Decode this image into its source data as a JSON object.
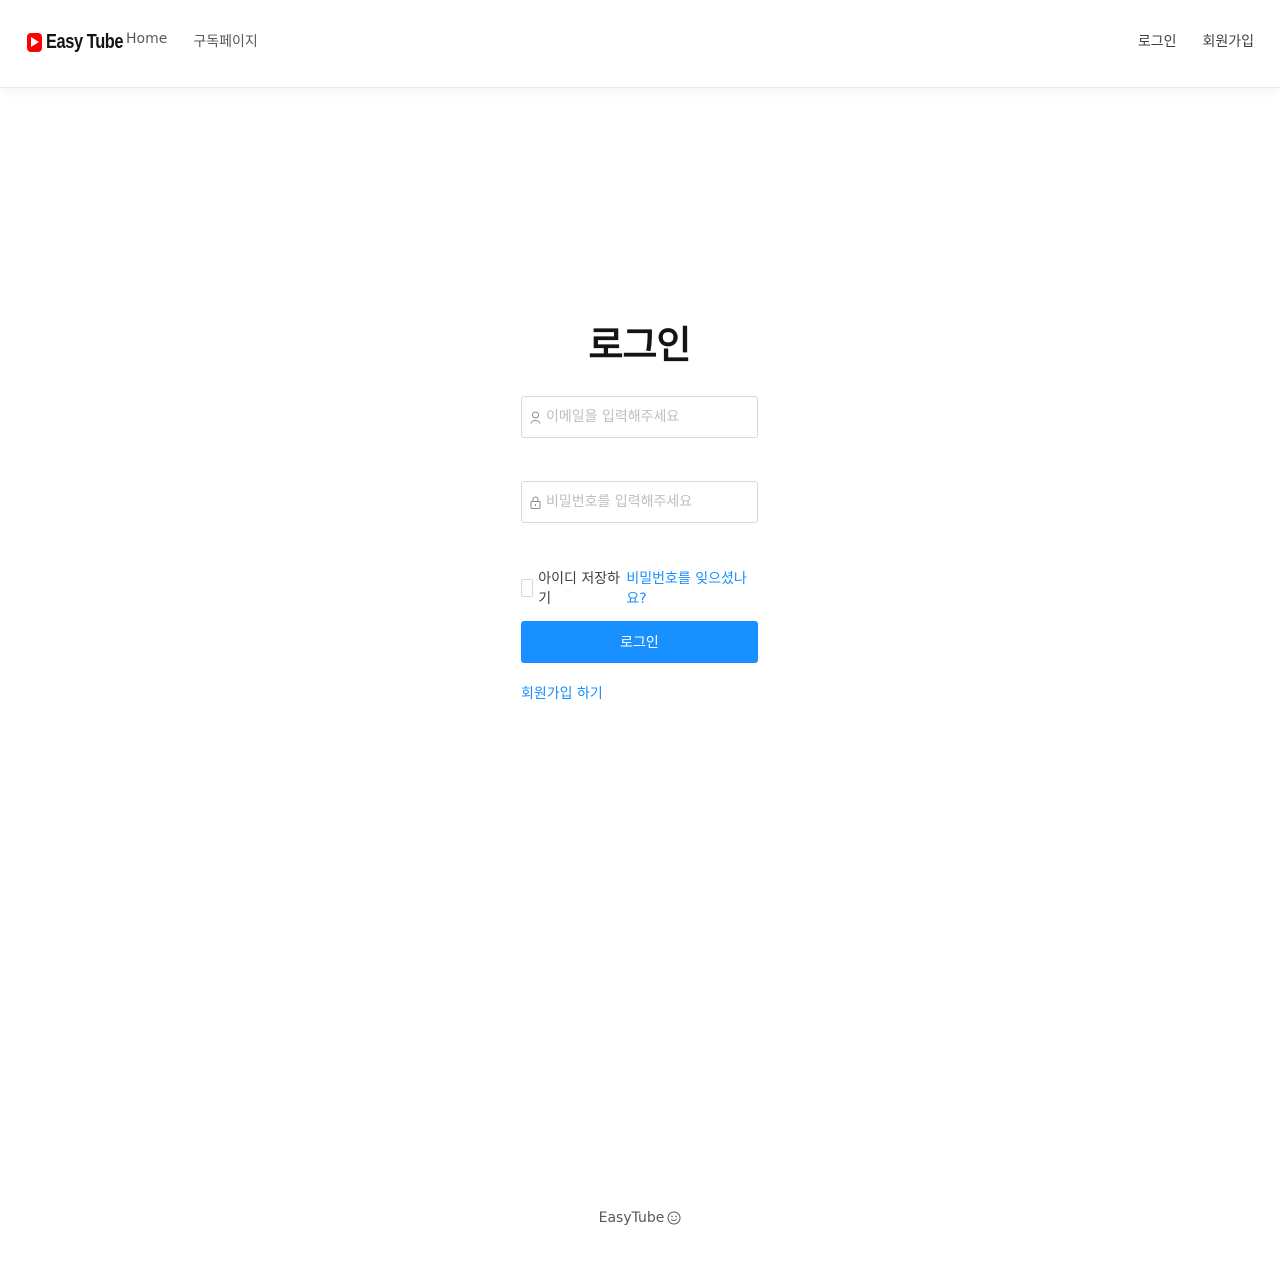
{
  "header": {
    "logo_text": "Easy Tube",
    "nav_left": [
      {
        "label": "Home"
      },
      {
        "label": "구독페이지"
      }
    ],
    "nav_right": [
      {
        "label": "로그인"
      },
      {
        "label": "회원가입"
      }
    ]
  },
  "login": {
    "title": "로그인",
    "email": {
      "placeholder": "이메일을 입력해주세요",
      "value": "",
      "icon": "user-icon"
    },
    "password": {
      "placeholder": "비밀번호를 입력해주세요",
      "value": "",
      "icon": "lock-icon"
    },
    "remember_label": "아이디 저장하기",
    "remember_checked": false,
    "forgot_label": "비밀번호를 잊으셨나요?",
    "submit_label": "로그인",
    "signup_label": "회원가입 하기"
  },
  "footer": {
    "text": "EasyTube",
    "icon": "smile-icon"
  },
  "colors": {
    "brand_red": "#ff0000",
    "primary": "#1890ff",
    "text": "#262626",
    "placeholder": "#bfbfbf",
    "border": "#d9d9d9"
  }
}
